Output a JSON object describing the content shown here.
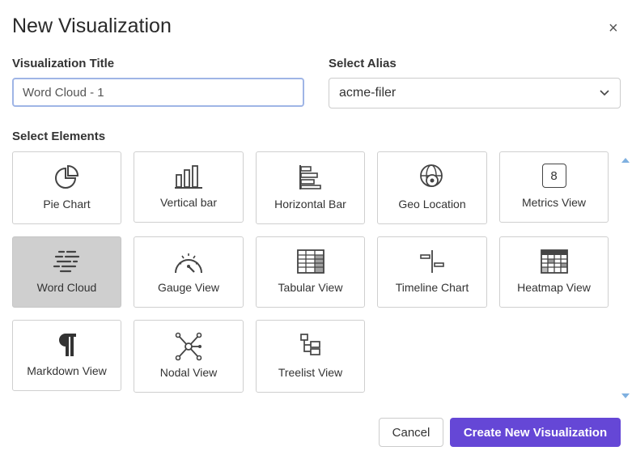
{
  "dialog": {
    "title": "New Visualization",
    "close_label": "×"
  },
  "form": {
    "title_label": "Visualization Title",
    "title_value": "Word Cloud - 1",
    "alias_label": "Select Alias",
    "alias_value": "acme-filer",
    "elements_label": "Select Elements"
  },
  "elements": [
    {
      "label": "Pie Chart",
      "icon": "pie-chart-icon",
      "selected": false
    },
    {
      "label": "Vertical bar",
      "icon": "vertical-bar-icon",
      "selected": false
    },
    {
      "label": "Horizontal Bar",
      "icon": "horizontal-bar-icon",
      "selected": false
    },
    {
      "label": "Geo Location",
      "icon": "globe-icon",
      "selected": false
    },
    {
      "label": "Metrics View",
      "icon": "metrics-icon",
      "icon_text": "8",
      "selected": false
    },
    {
      "label": "Word Cloud",
      "icon": "word-cloud-icon",
      "selected": true
    },
    {
      "label": "Gauge View",
      "icon": "gauge-icon",
      "selected": false
    },
    {
      "label": "Tabular View",
      "icon": "table-icon",
      "selected": false
    },
    {
      "label": "Timeline Chart",
      "icon": "timeline-icon",
      "selected": false
    },
    {
      "label": "Heatmap View",
      "icon": "heatmap-icon",
      "selected": false
    },
    {
      "label": "Markdown View",
      "icon": "pilcrow-icon",
      "selected": false
    },
    {
      "label": "Nodal View",
      "icon": "nodal-icon",
      "selected": false
    },
    {
      "label": "Treelist View",
      "icon": "treelist-icon",
      "selected": false
    }
  ],
  "footer": {
    "cancel_label": "Cancel",
    "create_label": "Create New Visualization"
  },
  "colors": {
    "primary": "#6547d6",
    "selected_card": "#cfcfcf",
    "input_focus": "#9fb5e6"
  }
}
